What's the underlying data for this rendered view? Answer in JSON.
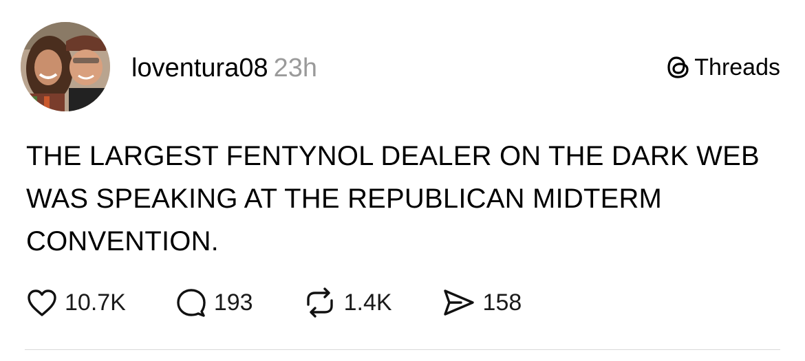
{
  "post": {
    "username": "loventura08",
    "timestamp": "23h",
    "brand": "Threads",
    "text": "THE LARGEST FENTYNOL DEALER ON THE DARK WEB WAS SPEAKING AT THE REPUBLICAN MIDTERM CONVENTION.",
    "stats": {
      "likes": "10.7K",
      "replies": "193",
      "reposts": "1.4K",
      "shares": "158"
    }
  },
  "icons": {
    "brand": "threads-logo-icon",
    "like": "heart-icon",
    "reply": "speech-bubble-icon",
    "repost": "repost-arrows-icon",
    "share": "send-paper-plane-icon"
  }
}
